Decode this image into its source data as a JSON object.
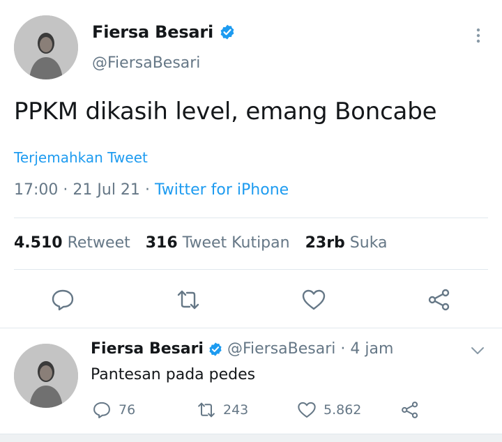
{
  "tweet": {
    "author_name": "Fiersa Besari",
    "author_handle": "@FiersaBesari",
    "text": "PPKM dikasih level, emang Boncabe",
    "translate_label": "Terjemahkan Tweet",
    "time": "17:00",
    "date": "21 Jul 21",
    "separator": "·",
    "source": "Twitter for iPhone",
    "stats": {
      "retweets": {
        "count": "4.510",
        "label": "Retweet"
      },
      "quotes": {
        "count": "316",
        "label": "Tweet Kutipan"
      },
      "likes": {
        "count": "23rb",
        "label": "Suka"
      }
    }
  },
  "reply": {
    "author_name": "Fiersa Besari",
    "meta": "@FiersaBesari · 4 jam",
    "text": "Pantesan pada pedes",
    "reply_count": "76",
    "retweet_count": "243",
    "like_count": "5.862"
  },
  "colors": {
    "accent": "#1d9bf0",
    "muted": "#657786",
    "text": "#14171a",
    "divider": "#e1e8ed"
  },
  "icons": [
    "verified-badge-icon",
    "more-vertical-icon",
    "reply-icon",
    "retweet-icon",
    "like-icon",
    "share-icon",
    "chevron-down-icon"
  ]
}
